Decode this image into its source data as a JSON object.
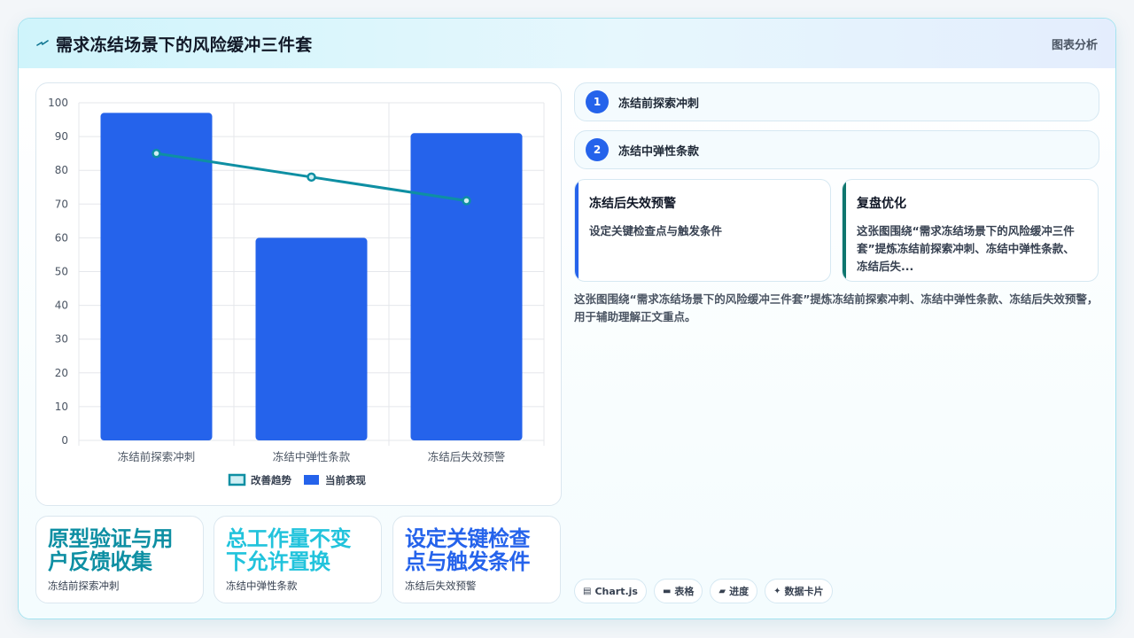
{
  "header": {
    "title": "需求冻结场景下的风险缓冲三件套",
    "analysis_label": "图表分析"
  },
  "chart_data": {
    "type": "bar",
    "categories": [
      "冻结前探索冲刺",
      "冻结中弹性条款",
      "冻结后失效预警"
    ],
    "series": [
      {
        "name": "改善趋势",
        "type": "line",
        "values": [
          85,
          78,
          71
        ],
        "color": "#0e8fa3"
      },
      {
        "name": "当前表现",
        "type": "bar",
        "values": [
          97,
          60,
          91
        ],
        "color": "#2563eb"
      }
    ],
    "ylim": [
      0,
      100
    ],
    "yticks": [
      "0",
      "10",
      "20",
      "30",
      "40",
      "50",
      "60",
      "70",
      "80",
      "90",
      "100"
    ],
    "grid": true,
    "legend_position": "bottom"
  },
  "stats": [
    {
      "value": "原型验证与用户反馈收集",
      "label": "冻结前探索冲刺",
      "color": "#0e8fa3"
    },
    {
      "value": "总工作量不变下允许置换",
      "label": "冻结中弹性条款",
      "color": "#22c3dc"
    },
    {
      "value": "设定关键检查点与触发条件",
      "label": "冻结后失效预警",
      "color": "#2563eb"
    }
  ],
  "steps": [
    {
      "num": "1",
      "text": "冻结前探索冲刺"
    },
    {
      "num": "2",
      "text": "冻结中弹性条款"
    }
  ],
  "cards": [
    {
      "title": "冻结后失效预警",
      "body": "设定关键检查点与触发条件",
      "accent": "#2563eb"
    },
    {
      "title": "复盘优化",
      "body": "这张图围绕“需求冻结场景下的风险缓冲三件套”提炼冻结前探索冲刺、冻结中弹性条款、冻结后失...",
      "accent": "#0f766e"
    }
  ],
  "summary": "这张图围绕“需求冻结场景下的风险缓冲三件套”提炼冻结前探索冲刺、冻结中弹性条款、冻结后失效预警，用于辅助理解正文重点。",
  "tags": [
    {
      "icon": "▤",
      "label": "Chart.js"
    },
    {
      "icon": "▬",
      "label": "表格"
    },
    {
      "icon": "▰",
      "label": "进度"
    },
    {
      "icon": "✦",
      "label": "数据卡片"
    }
  ]
}
